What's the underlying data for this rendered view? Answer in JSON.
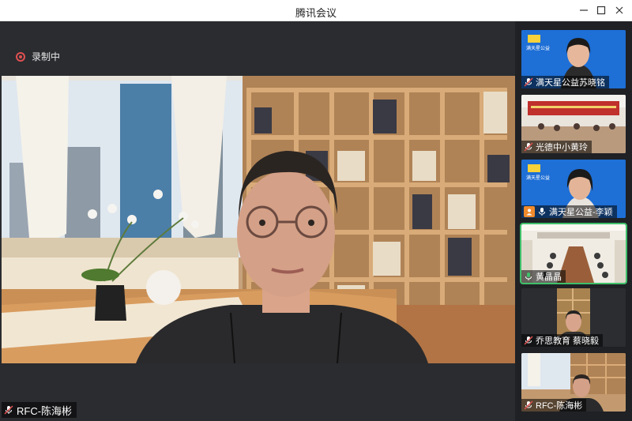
{
  "window": {
    "title": "腾讯会议",
    "minimize_icon": "minimize-icon",
    "maximize_icon": "maximize-icon",
    "close_icon": "close-icon"
  },
  "recording": {
    "label": "录制中"
  },
  "main_video": {
    "participant": "RFC-陈海彬"
  },
  "participants": [
    {
      "label": "满天星公益苏晓铭",
      "badge": "满天星公益"
    },
    {
      "label": "光德中小黄玲"
    },
    {
      "label": "满天星公益-李颖",
      "badge": "满天星公益"
    },
    {
      "label": "黄晶晶"
    },
    {
      "label": "乔思教育 蔡晓毅"
    },
    {
      "label": "RFC-陈海彬"
    }
  ],
  "colors": {
    "accent_green": "#3fbf6a",
    "record_red": "#e05050",
    "profile_orange": "#f08a2c",
    "blue_bg": "#1e6fd6"
  }
}
